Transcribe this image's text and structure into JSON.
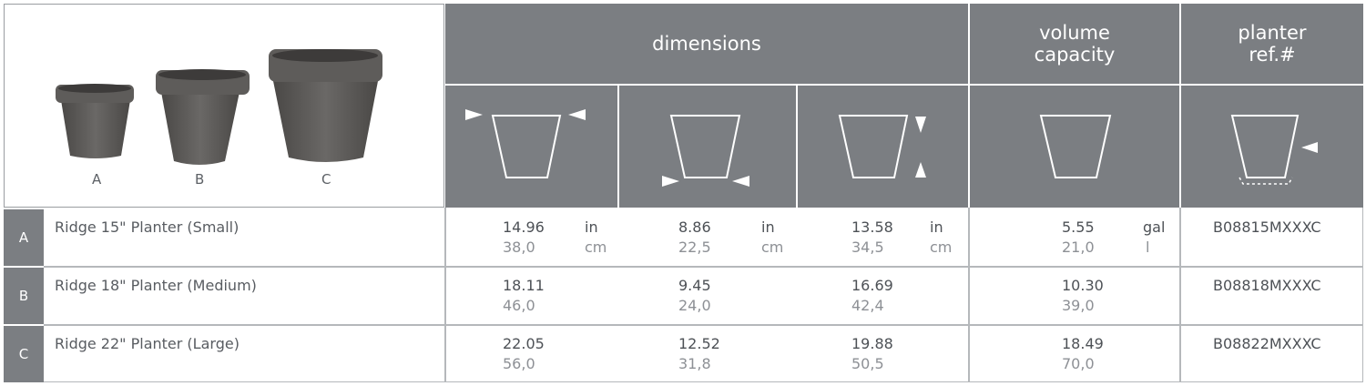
{
  "header": {
    "dimensions": "dimensions",
    "volume": "volume\ncapacity",
    "ref": "planter\nref.#"
  },
  "pot_labels": [
    "A",
    "B",
    "C"
  ],
  "units": {
    "imperial_length": "in",
    "metric_length": "cm",
    "imperial_volume": "gal",
    "metric_volume": "l"
  },
  "rows": [
    {
      "label": "A",
      "name": "Ridge 15\" Planter (Small)",
      "top_dia": {
        "imperial": "14.96",
        "metric": "38,0"
      },
      "bottom_dia": {
        "imperial": "8.86",
        "metric": "22,5"
      },
      "height": {
        "imperial": "13.58",
        "metric": "34,5"
      },
      "volume": {
        "imperial": "5.55",
        "metric": "21,0"
      },
      "ref": "B08815MXXXC"
    },
    {
      "label": "B",
      "name": "Ridge 18\" Planter (Medium)",
      "top_dia": {
        "imperial": "18.11",
        "metric": "46,0"
      },
      "bottom_dia": {
        "imperial": "9.45",
        "metric": "24,0"
      },
      "height": {
        "imperial": "16.69",
        "metric": "42,4"
      },
      "volume": {
        "imperial": "10.30",
        "metric": "39,0"
      },
      "ref": "B08818MXXXC"
    },
    {
      "label": "C",
      "name": "Ridge 22\" Planter (Large)",
      "top_dia": {
        "imperial": "22.05",
        "metric": "56,0"
      },
      "bottom_dia": {
        "imperial": "12.52",
        "metric": "31,8"
      },
      "height": {
        "imperial": "19.88",
        "metric": "50,5"
      },
      "volume": {
        "imperial": "18.49",
        "metric": "70,0"
      },
      "ref": "B08822MXXXC"
    }
  ],
  "colors": {
    "header_bg": "#7b7e82",
    "pot": "#5a5856"
  },
  "icons": [
    "top-diameter-icon",
    "bottom-diameter-icon",
    "height-icon",
    "volume-icon",
    "reference-icon"
  ]
}
